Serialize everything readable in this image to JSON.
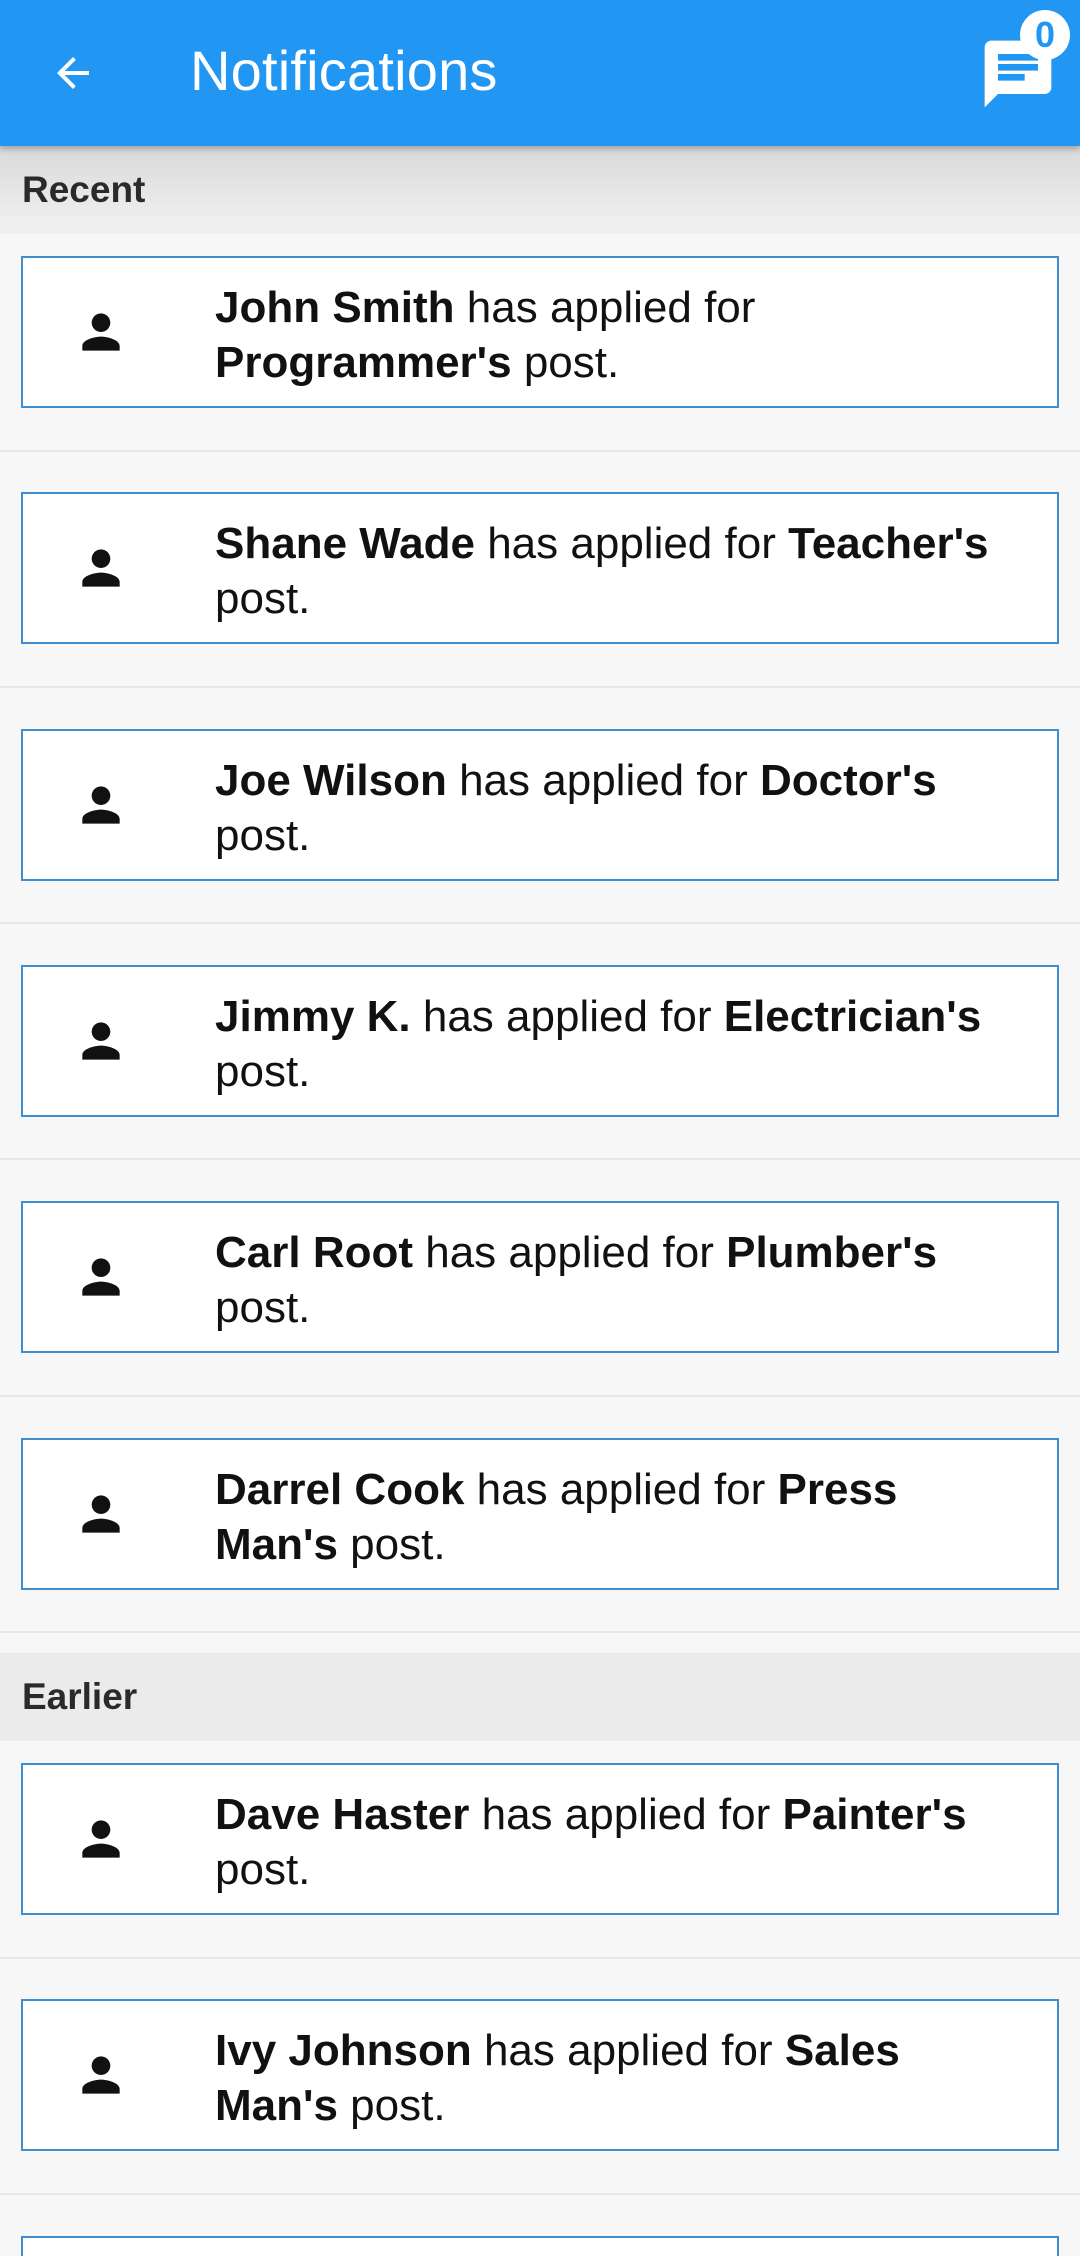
{
  "appbar": {
    "title": "Notifications",
    "badge_count": "0",
    "color": "#2196F3"
  },
  "sections": [
    {
      "label": "Recent",
      "items": [
        {
          "name": "John Smith",
          "middle": " has applied for ",
          "job": "Programmer's",
          "tail": " post."
        },
        {
          "name": "Shane Wade",
          "middle": " has applied for ",
          "job": "Teacher's",
          "tail": " post."
        },
        {
          "name": "Joe Wilson",
          "middle": " has applied for ",
          "job": "Doctor's",
          "tail": " post."
        },
        {
          "name": "Jimmy K.",
          "middle": " has applied for ",
          "job": "Electrician's",
          "tail": " post."
        },
        {
          "name": "Carl Root",
          "middle": " has applied for ",
          "job": "Plumber's",
          "tail": " post."
        },
        {
          "name": "Darrel Cook",
          "middle": " has applied for ",
          "job": "Press Man's",
          "tail": " post."
        }
      ]
    },
    {
      "label": "Earlier",
      "items": [
        {
          "name": "Dave Haster",
          "middle": " has applied for ",
          "job": "Painter's",
          "tail": " post."
        },
        {
          "name": "Ivy Johnson",
          "middle": " has applied for ",
          "job": "Sales Man's",
          "tail": " post."
        }
      ]
    }
  ],
  "icons": {
    "back": "arrow-back-icon",
    "chat": "chat-icon",
    "person": "person-icon"
  }
}
